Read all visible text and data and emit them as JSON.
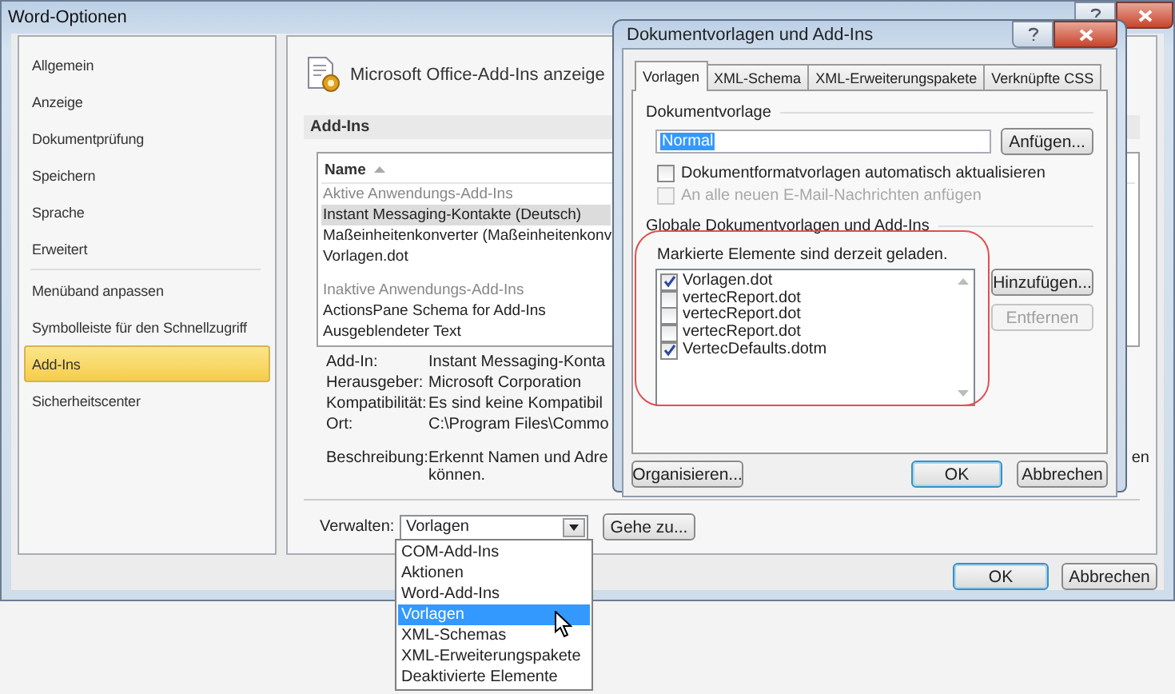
{
  "main_window": {
    "title": "Word-Optionen",
    "sidebar": {
      "sections": [
        {
          "items": [
            {
              "label": "Allgemein",
              "selected": false
            },
            {
              "label": "Anzeige",
              "selected": false
            },
            {
              "label": "Dokumentprüfung",
              "selected": false
            },
            {
              "label": "Speichern",
              "selected": false
            },
            {
              "label": "Sprache",
              "selected": false
            },
            {
              "label": "Erweitert",
              "selected": false
            }
          ]
        },
        {
          "items": [
            {
              "label": "Menüband anpassen",
              "selected": false
            },
            {
              "label": "Symbolleiste für den Schnellzugriff",
              "selected": false
            },
            {
              "label": "Add-Ins",
              "selected": true
            },
            {
              "label": "Sicherheitscenter",
              "selected": false
            }
          ]
        }
      ]
    },
    "header": "Microsoft Office-Add-Ins anzeige",
    "section_title": "Add-Ins",
    "addin_table": {
      "column": "Name",
      "groups": [
        {
          "heading": "Aktive Anwendungs-Add-Ins",
          "rows": [
            {
              "name": "Instant Messaging-Kontakte (Deutsch)",
              "selected": true
            },
            {
              "name": "Maßeinheitenkonverter (Maßeinheitenkonv",
              "selected": false
            },
            {
              "name": "Vorlagen.dot",
              "selected": false
            }
          ]
        },
        {
          "heading": "Inaktive Anwendungs-Add-Ins",
          "rows": [
            {
              "name": "ActionsPane Schema for Add-Ins",
              "selected": false
            },
            {
              "name": "Ausgeblendeter Text",
              "selected": false
            }
          ]
        }
      ]
    },
    "details": [
      {
        "label": "Add-In:",
        "value": "Instant Messaging-Konta"
      },
      {
        "label": "Herausgeber:",
        "value": "Microsoft Corporation"
      },
      {
        "label": "Kompatibilität:",
        "value": "Es sind keine Kompatibil"
      },
      {
        "label": "Ort:",
        "value": "C:\\Program Files\\Commo"
      }
    ],
    "description": {
      "label": "Beschreibung:",
      "lines": [
        "Erkennt Namen und Adre",
        "können."
      ],
      "tail": "en"
    },
    "manage": {
      "label": "Verwalten:",
      "value": "Vorlagen",
      "go_button": "Gehe zu...",
      "expanded": true,
      "options": [
        {
          "label": "COM-Add-Ins",
          "selected": false
        },
        {
          "label": "Aktionen",
          "selected": false
        },
        {
          "label": "Word-Add-Ins",
          "selected": false
        },
        {
          "label": "Vorlagen",
          "selected": true
        },
        {
          "label": "XML-Schemas",
          "selected": false
        },
        {
          "label": "XML-Erweiterungspakete",
          "selected": false
        },
        {
          "label": "Deaktivierte Elemente",
          "selected": false
        }
      ]
    },
    "buttons": [
      {
        "label": "OK",
        "default": true
      },
      {
        "label": "Abbrechen",
        "default": false
      }
    ]
  },
  "dialog": {
    "title": "Dokumentvorlagen und Add-Ins",
    "tabs": [
      {
        "label": "Vorlagen",
        "selected": true
      },
      {
        "label": "XML-Schema",
        "selected": false
      },
      {
        "label": "XML-Erweiterungspakete",
        "selected": false
      },
      {
        "label": "Verknüpfte CSS",
        "selected": false
      }
    ],
    "template_group": {
      "label": "Dokumentvorlage",
      "value": "Normal",
      "attach_button": "Anfügen...",
      "options": [
        {
          "label": "Dokumentformatvorlagen automatisch aktualisieren",
          "checked": false,
          "disabled": false
        },
        {
          "label": "An alle neuen E-Mail-Nachrichten anfügen",
          "checked": false,
          "disabled": true
        }
      ]
    },
    "global_group": {
      "label": "Globale Dokumentvorlagen und Add-Ins",
      "hint": "Markierte Elemente sind derzeit geladen.",
      "items": [
        {
          "label": "Vorlagen.dot",
          "checked": true
        },
        {
          "label": "vertecReport.dot",
          "checked": false
        },
        {
          "label": "vertecReport.dot",
          "checked": false
        },
        {
          "label": "vertecReport.dot",
          "checked": false
        },
        {
          "label": "VertecDefaults.dotm",
          "checked": true
        }
      ],
      "buttons": [
        {
          "label": "Hinzufügen...",
          "disabled": false
        },
        {
          "label": "Entfernen",
          "disabled": true
        }
      ]
    },
    "footer_buttons": [
      {
        "label": "Organisieren...",
        "default": false
      },
      {
        "label": "OK",
        "default": true
      },
      {
        "label": "Abbrechen",
        "default": false
      }
    ]
  }
}
